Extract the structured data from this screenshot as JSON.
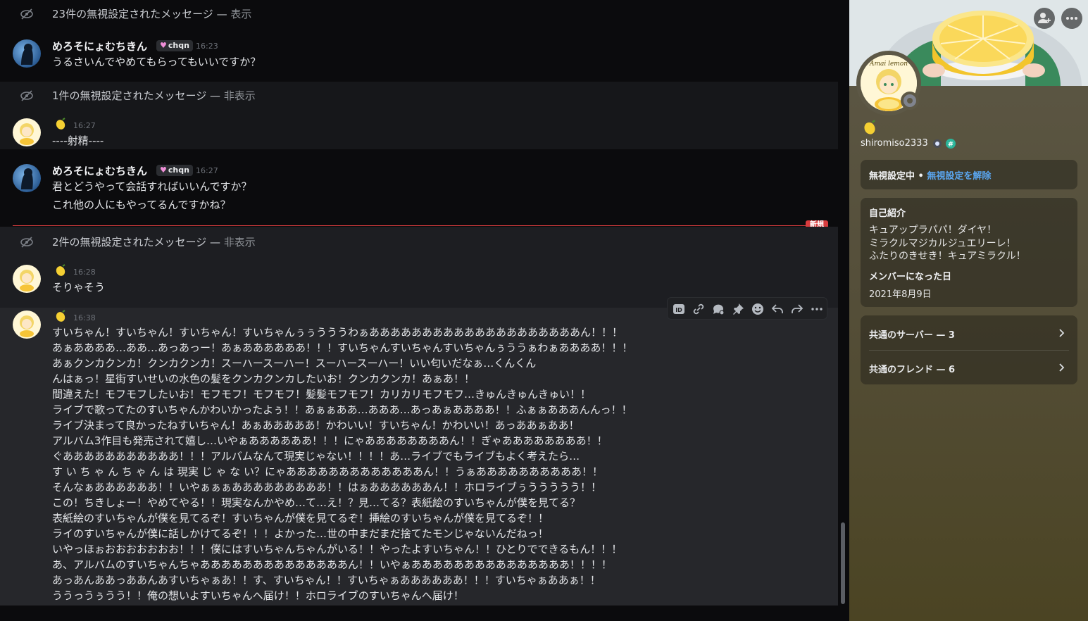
{
  "chat": {
    "ignored_1": {
      "text": "23件の無視設定されたメッセージ",
      "toggle": "表示"
    },
    "msg_1": {
      "author": "めろそにょむちきん",
      "tag": "chqn",
      "time": "16:23",
      "lines": [
        "うるさいんでやめてもらってもいいですか？"
      ]
    },
    "ignored_2": {
      "text": "1件の無視設定されたメッセージ",
      "toggle": "非表示"
    },
    "msg_2": {
      "time": "16:27",
      "lines": [
        "----射精----"
      ]
    },
    "msg_3": {
      "author": "めろそにょむちきん",
      "tag": "chqn",
      "time": "16:27",
      "lines": [
        "君とどうやって会話すればいいんですか？",
        "これ他の人にもやってるんですかね？"
      ]
    },
    "new_badge": "新規",
    "ignored_3": {
      "text": "2件の無視設定されたメッセージ",
      "toggle": "非表示"
    },
    "msg_4": {
      "time": "16:28",
      "lines": [
        "そりゃそう"
      ]
    },
    "msg_5": {
      "time": "16:38",
      "lines": [
        "すいちゃん！すいちゃん！すいちゃん！すいちゃんぅぅうううわぁああああああああああああああああああああん！！！",
        "あぁああああ…ああ…あっあっー！あぁああああああ！！！すいちゃんすいちゃんすいちゃんぅううぁわぁああああ！！！",
        "あぁクンカクンカ！クンカクンカ！スーハースーハー！スーハースーハー！いい匂いだなぁ…くんくん",
        "んはぁっ！星街すいせいの水色の髪をクンカクンカしたいお！クンカクンカ！あぁあ！！",
        "間違えた！モフモフしたいお！モフモフ！モフモフ！髪髪モフモフ！カリカリモフモフ…きゅんきゅんきゅい！！",
        "ライブで歌ってたのすいちゃんかわいかったよぅ！！あぁぁああ…あああ…あっあぁああああ！！ふぁぁあああんんっ！！",
        "ライブ決まって良かったねすいちゃん！あぁあああああ！かわいい！すいちゃん！かわいい！あっああぁああ！",
        "アルバム3作目も発売されて嬉し…いやぁああああああ！！！にゃああああああああん！！ぎゃああああああああ！！",
        "ぐあああああああああああ！！！アルバムなんて現実じゃない！！！！あ…ライブでもライブもよく考えたら…",
        "す い ち ゃ ん ち ゃ ん は 現実 じ ゃ な い？にゃあああああああああああああん！！うぁああああああああああ！！",
        "そんなぁああああああ！！いやぁぁぁあああああああああ！！はぁああああああん！！ホロライブぅううううう！！",
        "この！ちきしょー！やめてやる！！現実なんかやめ…て…え！？見…てる？表紙絵のすいちゃんが僕を見てる？",
        "表紙絵のすいちゃんが僕を見てるぞ！すいちゃんが僕を見てるぞ！挿絵のすいちゃんが僕を見てるぞ！！",
        "ライのすいちゃんが僕に話しかけてるぞ！！！よかった…世の中まだまだ捨てたモンじゃないんだねっ！",
        "いやっほぉおおおおおおお！！！僕にはすいちゃんちゃんがいる！！やったよすいちゃん！！ひとりでできるもん！！！",
        "あ、アルバムのすいちゃんちゃああああああああああああああん！！いやぁあああああああああああああああ！！！！",
        "あっあんああっああんあすいちゃぁあ！！す、すいちゃん！！すいちゃぁああああああ！！！すいちゃぁああぁ！！",
        "ううっうぅうう！！俺の想いよすいちゃんへ届け！！ホロライブのすいちゃんへ届け！"
      ]
    },
    "toolbar_icons": [
      "id-icon",
      "link-icon",
      "thread-icon",
      "pin-icon",
      "emoji-icon",
      "reply-icon",
      "forward-icon",
      "more-icon"
    ]
  },
  "profile": {
    "display_name_emoji": "lemon-emoji",
    "username": "shiromiso2333",
    "ignored_label": "無視設定中",
    "dot": "•",
    "unignore_link": "無視設定を解除",
    "about_label": "自己紹介",
    "about_lines": [
      "キュアップラパパ！ダイヤ！",
      "ミラクルマジカルジュエリーレ！",
      "ふたりのきせき！キュアミラクル！"
    ],
    "member_since_label": "メンバーになった日",
    "member_since": "2021年8月9日",
    "mutual_servers": "共通のサーバー — 3",
    "mutual_friends": "共通のフレンド — 6",
    "avatar_text": "Amai lemon"
  },
  "colors": {
    "accent_link": "#5aa6f0",
    "new_red": "#d83c3e",
    "tag_heart": "#f08fd8"
  }
}
